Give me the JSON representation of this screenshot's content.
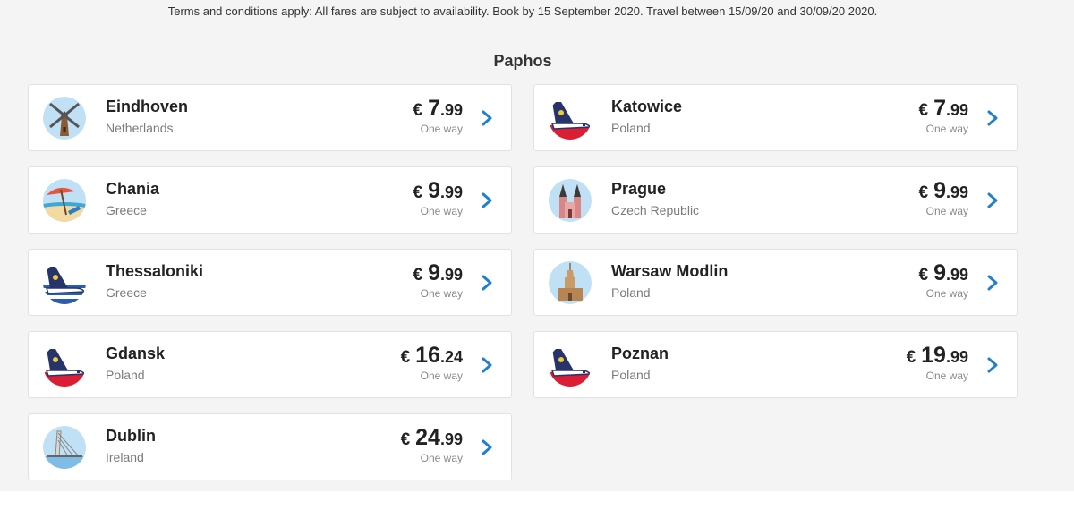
{
  "terms": "Terms and conditions apply: All fares are subject to availability. Book by 15 September 2020. Travel between 15/09/20 and 30/09/20 2020.",
  "origin": "Paphos",
  "fares": [
    {
      "city": "Eindhoven",
      "country": "Netherlands",
      "currency": "€",
      "int": "7",
      "dec": ".99",
      "note": "One way",
      "icon": "windmill-icon"
    },
    {
      "city": "Katowice",
      "country": "Poland",
      "currency": "€",
      "int": "7",
      "dec": ".99",
      "note": "One way",
      "icon": "plane-tail-icon"
    },
    {
      "city": "Chania",
      "country": "Greece",
      "currency": "€",
      "int": "9",
      "dec": ".99",
      "note": "One way",
      "icon": "beach-umbrella-icon"
    },
    {
      "city": "Prague",
      "country": "Czech Republic",
      "currency": "€",
      "int": "9",
      "dec": ".99",
      "note": "One way",
      "icon": "church-towers-icon"
    },
    {
      "city": "Thessaloniki",
      "country": "Greece",
      "currency": "€",
      "int": "9",
      "dec": ".99",
      "note": "One way",
      "icon": "plane-tail-icon"
    },
    {
      "city": "Warsaw Modlin",
      "country": "Poland",
      "currency": "€",
      "int": "9",
      "dec": ".99",
      "note": "One way",
      "icon": "palace-tower-icon"
    },
    {
      "city": "Gdansk",
      "country": "Poland",
      "currency": "€",
      "int": "16",
      "dec": ".24",
      "note": "One way",
      "icon": "plane-tail-icon"
    },
    {
      "city": "Poznan",
      "country": "Poland",
      "currency": "€",
      "int": "19",
      "dec": ".99",
      "note": "One way",
      "icon": "plane-tail-icon"
    },
    {
      "city": "Dublin",
      "country": "Ireland",
      "currency": "€",
      "int": "24",
      "dec": ".99",
      "note": "One way",
      "icon": "bridge-icon"
    }
  ],
  "colors": {
    "chevron": "#1f7fd1",
    "background": "#f4f4f4",
    "card": "#ffffff"
  }
}
